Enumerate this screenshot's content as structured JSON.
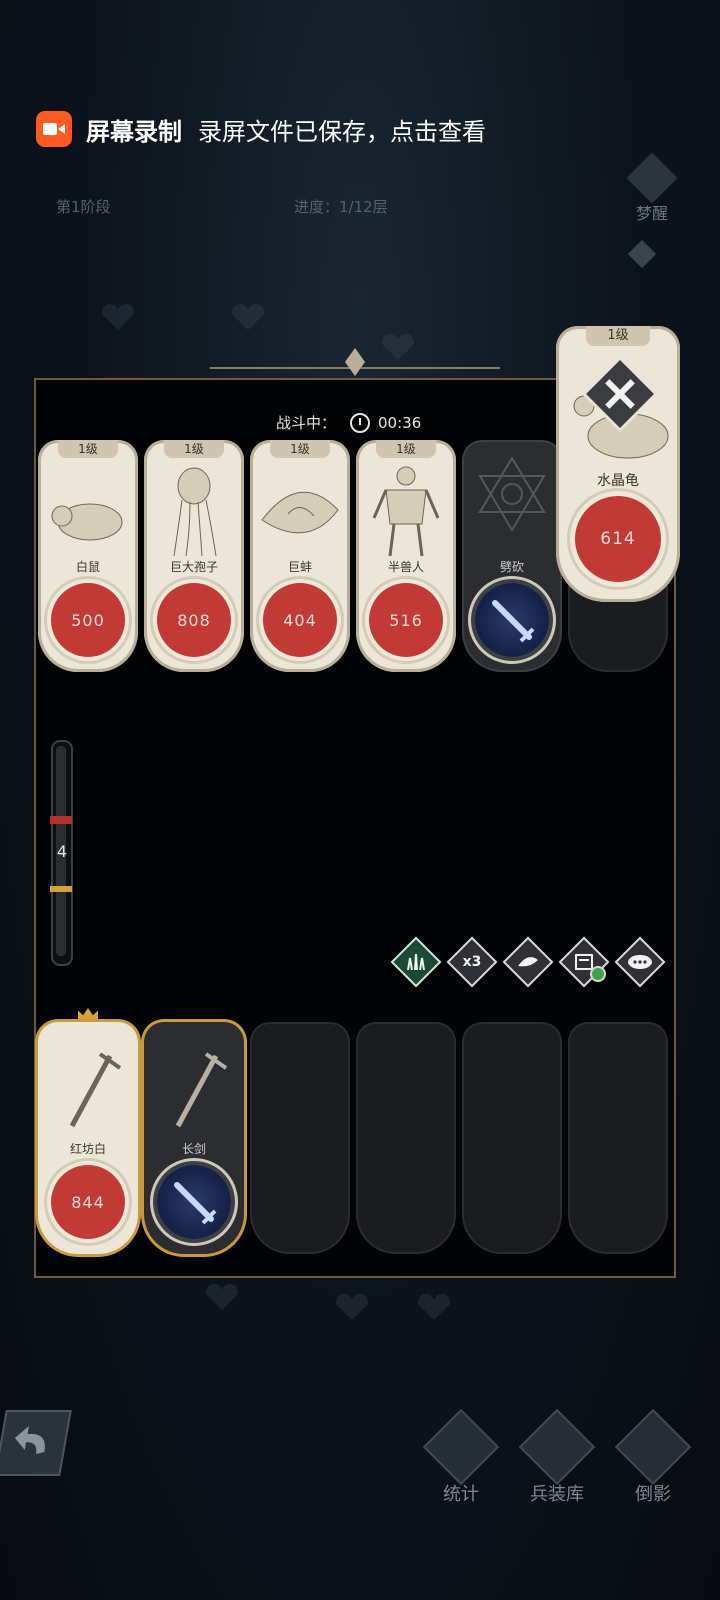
{
  "toast": {
    "app": "屏幕录制",
    "message": "录屏文件已保存，点击查看"
  },
  "header": {
    "stage": "第1阶段",
    "progress": "进度：1/12层",
    "awake": "梦醒"
  },
  "battle": {
    "status": "战斗中：",
    "timer": "00:36"
  },
  "enemies": [
    {
      "level": "1级",
      "name": "白鼠",
      "hp": "500"
    },
    {
      "level": "1级",
      "name": "巨大孢子",
      "hp": "808"
    },
    {
      "level": "1级",
      "name": "巨蚌",
      "hp": "404"
    },
    {
      "level": "1级",
      "name": "半兽人",
      "hp": "516"
    }
  ],
  "enemy_skill": {
    "name": "劈砍",
    "icon": "sword-icon"
  },
  "boss": {
    "level": "1级",
    "name": "水晶龟",
    "hp": "614"
  },
  "gauge": {
    "value": "4"
  },
  "actions": [
    {
      "label": "",
      "icon": "spikes-icon"
    },
    {
      "label": "x3",
      "icon": "speed-icon"
    },
    {
      "label": "",
      "icon": "leaf-icon"
    },
    {
      "label": "",
      "icon": "card-icon"
    },
    {
      "label": "",
      "icon": "chat-icon"
    }
  ],
  "hand": [
    {
      "name": "红坊白",
      "hp": "844",
      "icon": "sword-icon"
    },
    {
      "name": "长剑",
      "icon": "sword-icon"
    }
  ],
  "nav": {
    "stats": "统计",
    "armory": "兵装库",
    "shadow": "倒影"
  },
  "colors": {
    "hp_red": "#c23a36",
    "gold": "#c99a3b",
    "card_bg": "#ece6d8",
    "skill_blue": "#1a2754"
  }
}
